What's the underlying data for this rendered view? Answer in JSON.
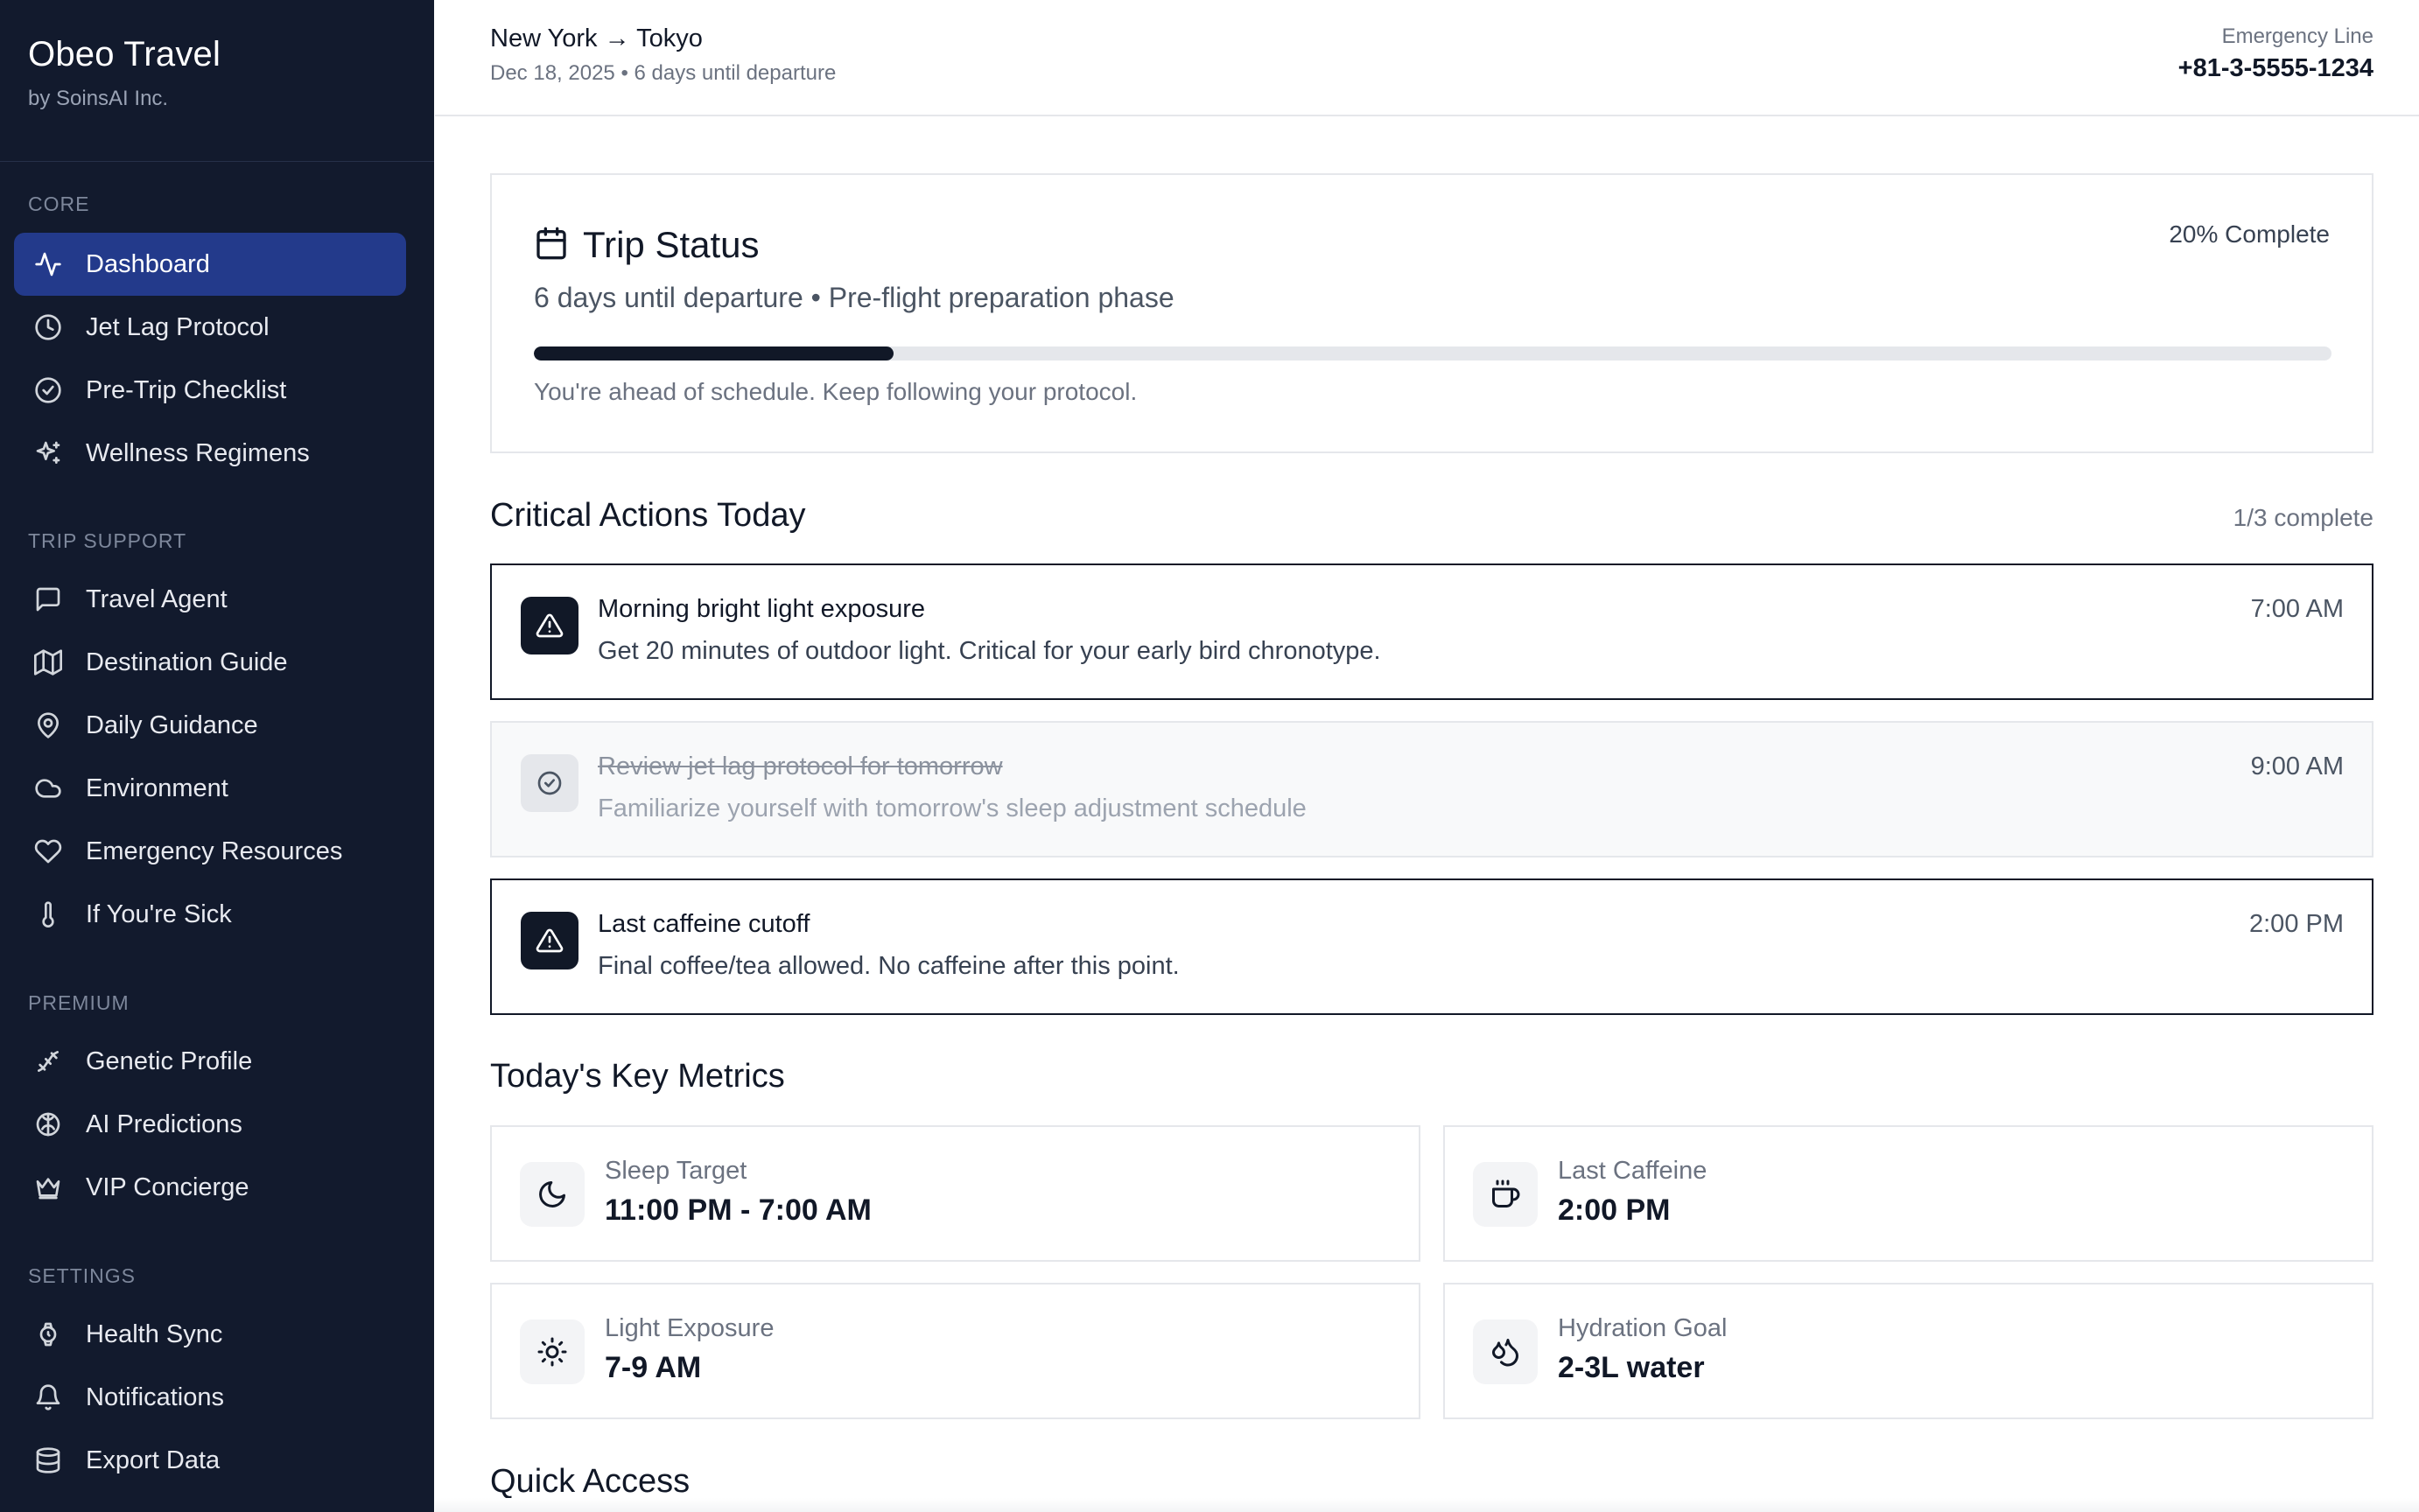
{
  "sidebar": {
    "brand_title": "Obeo Travel",
    "brand_sub": "by SoinsAI Inc.",
    "sections": {
      "core": "CORE",
      "trip_support": "TRIP SUPPORT",
      "premium": "PREMIUM",
      "settings": "SETTINGS"
    },
    "items": {
      "dashboard": {
        "label": "Dashboard",
        "icon": "activity-icon",
        "active": true
      },
      "jet_lag": {
        "label": "Jet Lag Protocol",
        "icon": "clock-icon"
      },
      "checklist": {
        "label": "Pre-Trip Checklist",
        "icon": "check-circle-icon"
      },
      "wellness": {
        "label": "Wellness Regimens",
        "icon": "sparkles-icon"
      },
      "travel_agent": {
        "label": "Travel Agent",
        "icon": "message-icon"
      },
      "destination": {
        "label": "Destination Guide",
        "icon": "map-icon"
      },
      "daily": {
        "label": "Daily Guidance",
        "icon": "map-pin-icon"
      },
      "environment": {
        "label": "Environment",
        "icon": "cloud-icon"
      },
      "emergency": {
        "label": "Emergency Resources",
        "icon": "heart-icon"
      },
      "sick": {
        "label": "If You're Sick",
        "icon": "thermometer-icon"
      },
      "genetic": {
        "label": "Genetic Profile",
        "icon": "dna-icon"
      },
      "ai": {
        "label": "AI Predictions",
        "icon": "brain-icon"
      },
      "vip": {
        "label": "VIP Concierge",
        "icon": "crown-icon"
      },
      "health_sync": {
        "label": "Health Sync",
        "icon": "watch-icon"
      },
      "notifications": {
        "label": "Notifications",
        "icon": "bell-icon"
      },
      "export": {
        "label": "Export Data",
        "icon": "database-icon"
      }
    }
  },
  "header": {
    "route": "New York → Tokyo",
    "departure_info": "Dec 18, 2025 • 6 days until departure",
    "emergency_label": "Emergency Line",
    "emergency_phone": "+81-3-5555-1234"
  },
  "trip_status": {
    "title": "Trip Status",
    "icon": "calendar-icon",
    "complete_label": "20% Complete",
    "progress": 0.2,
    "subtitle": "6 days until departure • Pre-flight preparation phase",
    "note": "You're ahead of schedule. Keep following your protocol."
  },
  "critical_actions": {
    "title": "Critical Actions Today",
    "count": "1/3 complete",
    "items": [
      {
        "title": "Morning bright light exposure",
        "desc": "Get 20 minutes of outdoor light. Critical for your early bird chronotype.",
        "time": "7:00 AM",
        "done": false,
        "icon": "alert-triangle-icon"
      },
      {
        "title": "Review jet lag protocol for tomorrow",
        "desc": "Familiarize yourself with tomorrow's sleep adjustment schedule",
        "time": "9:00 AM",
        "done": true,
        "icon": "check-circle-icon"
      },
      {
        "title": "Last caffeine cutoff",
        "desc": "Final coffee/tea allowed. No caffeine after this point.",
        "time": "2:00 PM",
        "done": false,
        "icon": "alert-triangle-icon"
      }
    ]
  },
  "metrics": {
    "title": "Today's Key Metrics",
    "items": [
      {
        "label": "Sleep Target",
        "value": "11:00 PM - 7:00 AM",
        "icon": "moon-icon"
      },
      {
        "label": "Last Caffeine",
        "value": "2:00 PM",
        "icon": "coffee-icon"
      },
      {
        "label": "Light Exposure",
        "value": "7-9 AM",
        "icon": "sun-icon"
      },
      {
        "label": "Hydration Goal",
        "value": "2-3L water",
        "icon": "droplets-icon"
      }
    ]
  },
  "quick_access": {
    "title": "Quick Access"
  },
  "colors": {
    "sidebar_bg": "#121a2d",
    "active_item": "#233a8b",
    "accent_dark": "#111827"
  }
}
